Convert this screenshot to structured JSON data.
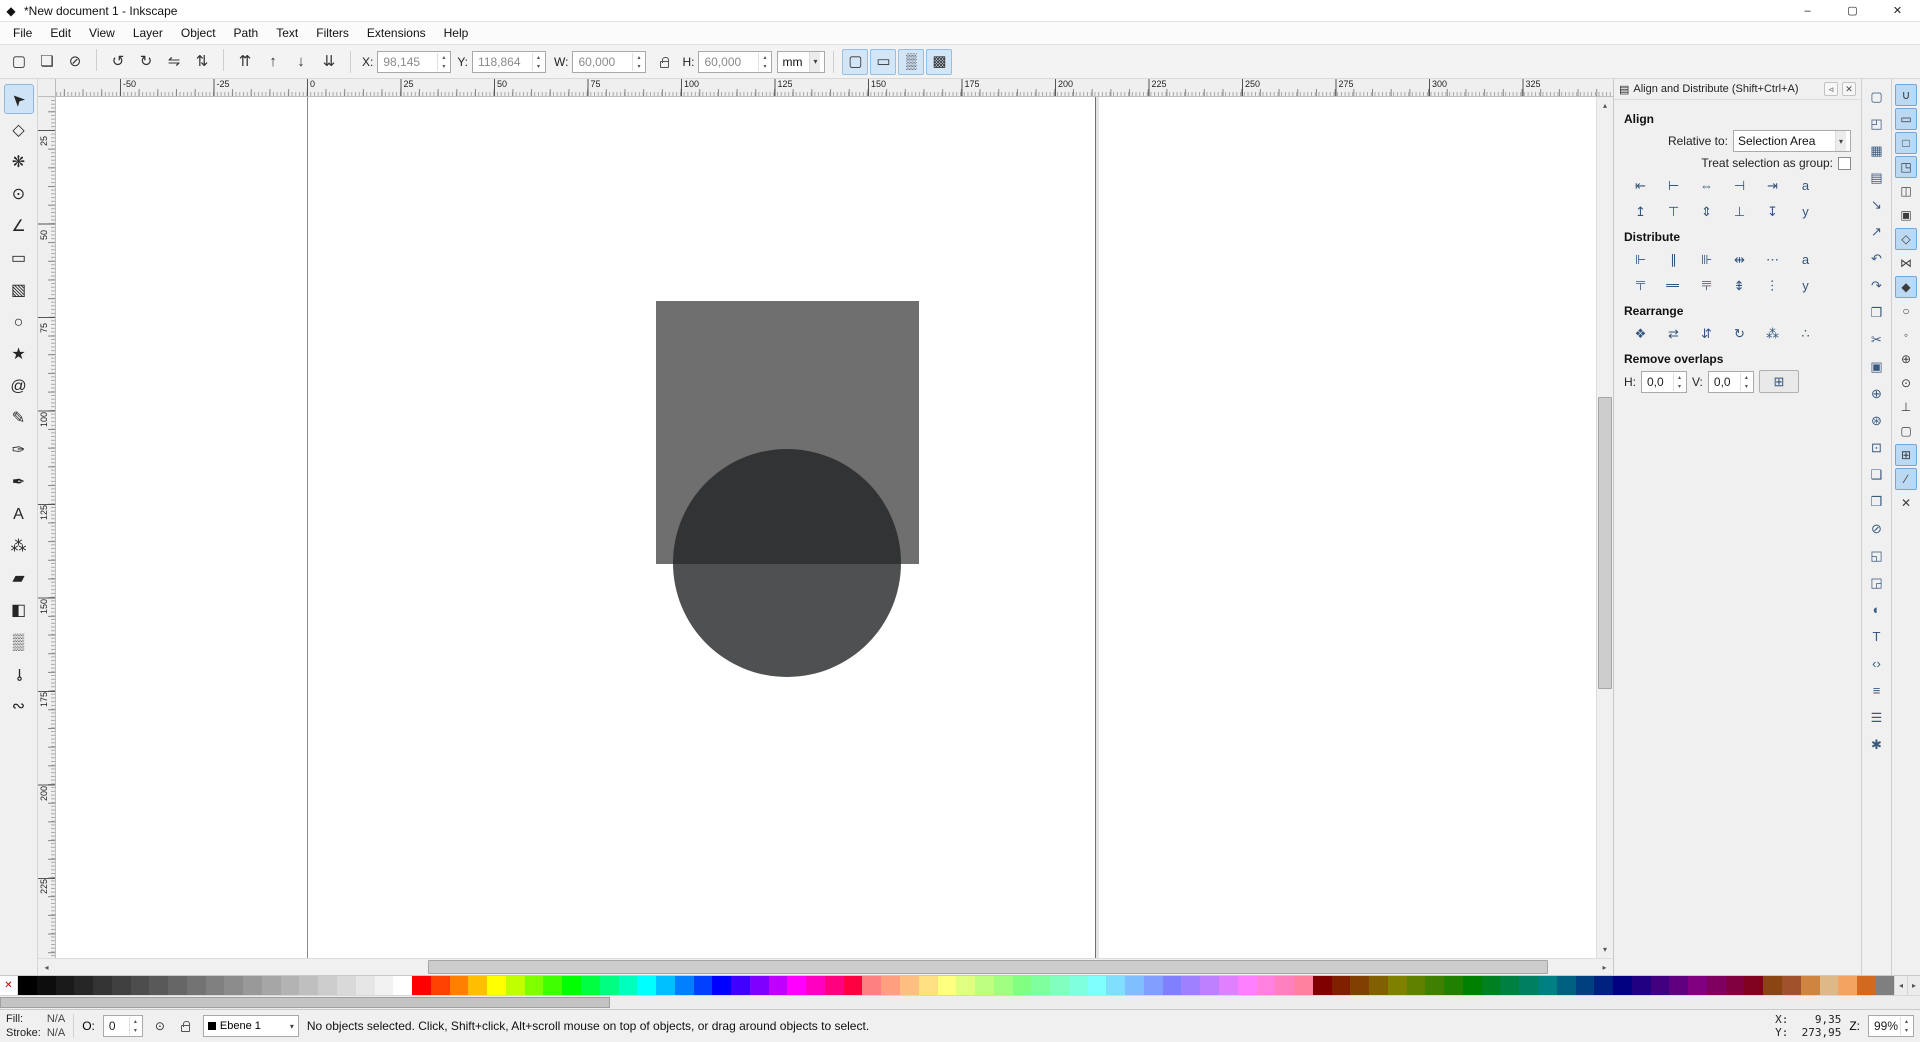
{
  "titlebar": {
    "icon": "◆",
    "title": "*New document 1 - Inkscape",
    "minimize": "–",
    "maximize": "▢",
    "close": "✕"
  },
  "menubar": {
    "items": [
      "File",
      "Edit",
      "View",
      "Layer",
      "Object",
      "Path",
      "Text",
      "Filters",
      "Extensions",
      "Help"
    ]
  },
  "options_toolbar": {
    "groups": [
      [
        {
          "name": "select-all-button",
          "glyph": "▢"
        },
        {
          "name": "select-all-layers-button",
          "glyph": "❏"
        },
        {
          "name": "deselect-button",
          "glyph": "⊘"
        }
      ],
      [
        {
          "name": "rotate-ccw-button",
          "glyph": "↺"
        },
        {
          "name": "rotate-cw-button",
          "glyph": "↻"
        },
        {
          "name": "flip-horizontal-button",
          "glyph": "⇋"
        },
        {
          "name": "flip-vertical-button",
          "glyph": "⇅"
        }
      ],
      [
        {
          "name": "raise-to-top-button",
          "glyph": "⇈"
        },
        {
          "name": "raise-button",
          "glyph": "↑"
        },
        {
          "name": "lower-button",
          "glyph": "↓"
        },
        {
          "name": "lower-to-bottom-button",
          "glyph": "⇊"
        }
      ]
    ],
    "fields_xy": [
      {
        "label": "X:",
        "value": "98,145",
        "name": "x-field"
      },
      {
        "label": "Y:",
        "value": "118,864",
        "name": "y-field"
      }
    ],
    "field_w": [
      {
        "label": "W:",
        "value": "60,000",
        "name": "w-field"
      }
    ],
    "field_h": [
      {
        "label": "H:",
        "value": "60,000",
        "name": "h-field"
      }
    ],
    "unit": "mm",
    "affect_buttons": [
      {
        "name": "scale-stroke-toggle",
        "glyph": "▢"
      },
      {
        "name": "scale-corners-toggle",
        "glyph": "▭"
      },
      {
        "name": "move-gradients-toggle",
        "glyph": "▒"
      },
      {
        "name": "move-patterns-toggle",
        "glyph": "▩"
      }
    ]
  },
  "toolbox": {
    "tools": [
      {
        "name": "selector-tool",
        "glyph": "➤",
        "rot": -135,
        "active": true
      },
      {
        "name": "node-editor-tool",
        "glyph": "◇"
      },
      {
        "name": "tweak-tool",
        "glyph": "❋"
      },
      {
        "name": "zoom-tool",
        "glyph": "⊙"
      },
      {
        "name": "measure-tool",
        "glyph": "∠"
      },
      {
        "name": "rectangle-tool",
        "glyph": "▭"
      },
      {
        "name": "3d-box-tool",
        "glyph": "▧"
      },
      {
        "name": "ellipse-tool",
        "glyph": "○"
      },
      {
        "name": "star-tool",
        "glyph": "★"
      },
      {
        "name": "spiral-tool",
        "glyph": "@"
      },
      {
        "name": "pencil-tool",
        "glyph": "✎"
      },
      {
        "name": "bezier-pen-tool",
        "glyph": "✑"
      },
      {
        "name": "calligraphy-tool",
        "glyph": "✒"
      },
      {
        "name": "text-tool",
        "glyph": "A"
      },
      {
        "name": "spray-tool",
        "glyph": "⁂"
      },
      {
        "name": "eraser-tool",
        "glyph": "▰"
      },
      {
        "name": "paint-bucket-tool",
        "glyph": "◧"
      },
      {
        "name": "gradient-tool",
        "glyph": "▒"
      },
      {
        "name": "dropper-tool",
        "glyph": "⊸",
        "rot": 90
      },
      {
        "name": "connector-tool",
        "glyph": "∾"
      }
    ]
  },
  "rulers": {
    "h": {
      "start": 64,
      "step": 93.5,
      "labels": [
        "-50",
        "-25",
        "0",
        "25",
        "50",
        "75",
        "100",
        "125",
        "150",
        "175",
        "200",
        "225",
        "250",
        "275",
        "300",
        "325"
      ]
    },
    "v": {
      "start": 33,
      "step": 93.5,
      "labels": [
        "25",
        "50",
        "75",
        "100",
        "125",
        "150",
        "175",
        "200",
        "225"
      ]
    }
  },
  "canvas": {
    "rect_color": "#6f6f6f",
    "circle_color": "rgba(34,36,38,0.8)"
  },
  "align_panel": {
    "title": "Align and Distribute (Shift+Ctrl+A)",
    "collapse_glyph": "◃",
    "close_glyph": "✕",
    "header_icon": "▤",
    "align_label": "Align",
    "relative_label": "Relative to:",
    "relative_value": "Selection Area",
    "group_label": "Treat selection as group:",
    "distribute_label": "Distribute",
    "rearrange_label": "Rearrange",
    "remove_label": "Remove overlaps",
    "align_row1": [
      {
        "name": "align-right-edges-to-left-of-anchor-button",
        "glyph": "⇤"
      },
      {
        "name": "align-left-edges-button",
        "glyph": "⊢"
      },
      {
        "name": "center-on-vertical-axis-button",
        "glyph": "⇔"
      },
      {
        "name": "align-right-edges-button",
        "glyph": "⊣"
      },
      {
        "name": "align-left-edges-to-right-of-anchor-button",
        "glyph": "⇥"
      },
      {
        "name": "align-text-anchors-horizontal-button",
        "glyph": "a"
      }
    ],
    "align_row2": [
      {
        "name": "align-bottom-edges-to-top-of-anchor-button",
        "glyph": "↥"
      },
      {
        "name": "align-top-edges-button",
        "glyph": "⊤"
      },
      {
        "name": "center-on-horizontal-axis-button",
        "glyph": "⇕"
      },
      {
        "name": "align-bottom-edges-button",
        "glyph": "⊥"
      },
      {
        "name": "align-top-edges-to-bottom-of-anchor-button",
        "glyph": "↧"
      },
      {
        "name": "align-text-baselines-button",
        "glyph": "y"
      }
    ],
    "distribute_row1": [
      {
        "name": "distribute-left-edges-button",
        "glyph": "⊩"
      },
      {
        "name": "distribute-centers-horizontally-button",
        "glyph": "∥"
      },
      {
        "name": "distribute-right-edges-button",
        "glyph": "⊪"
      },
      {
        "name": "make-horizontal-gaps-equal-button",
        "glyph": "⇹"
      },
      {
        "name": "distribute-text-anchors-horizontally-button",
        "glyph": "⋯"
      },
      {
        "name": "distribute-text-horizontal-button",
        "glyph": "a"
      }
    ],
    "distribute_row2": [
      {
        "name": "distribute-bottom-edges-button",
        "glyph": "⊩",
        "rot": 90
      },
      {
        "name": "distribute-centers-vertically-button",
        "glyph": "∥",
        "rot": 90
      },
      {
        "name": "distribute-top-edges-button",
        "glyph": "⊪",
        "rot": 90
      },
      {
        "name": "make-vertical-gaps-equal-button",
        "glyph": "⇹",
        "rot": 90
      },
      {
        "name": "distribute-text-anchors-vertically-button",
        "glyph": "⋯",
        "rot": 90
      },
      {
        "name": "distribute-text-baselines-vertically-button",
        "glyph": "y"
      }
    ],
    "rearrange_row": [
      {
        "name": "arrange-connector-network-button",
        "glyph": "❖"
      },
      {
        "name": "exchange-in-selection-order-button",
        "glyph": "⇄"
      },
      {
        "name": "exchange-in-stacking-order-button",
        "glyph": "⇵"
      },
      {
        "name": "exchange-clockwise-button",
        "glyph": "↻"
      },
      {
        "name": "randomize-centers-button",
        "glyph": "⁂"
      },
      {
        "name": "unclump-button",
        "glyph": "∴"
      }
    ],
    "remove": {
      "h_label": "H:",
      "h_value": "0,0",
      "v_label": "V:",
      "v_value": "0,0",
      "button_glyph": "⊞"
    }
  },
  "commands_bar": {
    "buttons": [
      {
        "name": "new-document-button",
        "glyph": "▢"
      },
      {
        "name": "open-document-button",
        "glyph": "◰"
      },
      {
        "name": "save-document-button",
        "glyph": "▦"
      },
      {
        "name": "print-document-button",
        "glyph": "▤"
      },
      {
        "name": "import-bitmap-button",
        "glyph": "↘"
      },
      {
        "name": "export-bitmap-button",
        "glyph": "↗"
      },
      {
        "name": "undo-button",
        "glyph": "↶"
      },
      {
        "name": "redo-button",
        "glyph": "↷"
      },
      {
        "name": "copy-button",
        "glyph": "❐"
      },
      {
        "name": "cut-button",
        "glyph": "✂"
      },
      {
        "name": "paste-button",
        "glyph": "▣"
      },
      {
        "name": "zoom-to-fit-selection-button",
        "glyph": "⊕"
      },
      {
        "name": "zoom-to-fit-drawing-button",
        "glyph": "⊛"
      },
      {
        "name": "zoom-to-fit-page-button",
        "glyph": "⊡"
      },
      {
        "name": "duplicate-button",
        "glyph": "❑"
      },
      {
        "name": "create-clone-button",
        "glyph": "❒"
      },
      {
        "name": "unlink-clone-button",
        "glyph": "⊘"
      },
      {
        "name": "group-objects-button",
        "glyph": "◱"
      },
      {
        "name": "ungroup-objects-button",
        "glyph": "◲"
      },
      {
        "name": "fill-stroke-dialog-button",
        "glyph": "◐"
      },
      {
        "name": "text-dialog-button",
        "glyph": "T"
      },
      {
        "name": "xml-editor-button",
        "glyph": "‹›"
      },
      {
        "name": "align-dialog-button",
        "glyph": "≡"
      },
      {
        "name": "document-properties-button",
        "glyph": "☰"
      },
      {
        "name": "preferences-button",
        "glyph": "✱"
      }
    ]
  },
  "snap_bar": {
    "buttons": [
      {
        "name": "snap-enable-button",
        "glyph": "∪",
        "active": true
      },
      {
        "name": "snap-bounding-box-button",
        "glyph": "▭",
        "active": true
      },
      {
        "name": "snap-bbox-edges-button",
        "glyph": "□",
        "active": true
      },
      {
        "name": "snap-bbox-corners-button",
        "glyph": "◳",
        "active": true
      },
      {
        "name": "snap-bbox-edge-midpoints-button",
        "glyph": "◫"
      },
      {
        "name": "snap-bbox-centers-button",
        "glyph": "▣"
      },
      {
        "name": "snap-nodes-button",
        "glyph": "◇",
        "active": true
      },
      {
        "name": "snap-path-intersections-button",
        "glyph": "⋈"
      },
      {
        "name": "snap-cusp-nodes-button",
        "glyph": "◆",
        "active": true
      },
      {
        "name": "snap-smooth-nodes-button",
        "glyph": "○"
      },
      {
        "name": "snap-line-midpoints-button",
        "glyph": "◦"
      },
      {
        "name": "snap-object-centers-button",
        "glyph": "⊕"
      },
      {
        "name": "snap-rotation-centers-button",
        "glyph": "⊙"
      },
      {
        "name": "snap-text-baselines-button",
        "glyph": "⊥"
      },
      {
        "name": "snap-page-border-button",
        "glyph": "▢"
      },
      {
        "name": "snap-grids-button",
        "glyph": "⊞",
        "active": true
      },
      {
        "name": "snap-guides-button",
        "glyph": "∕",
        "active": true
      },
      {
        "name": "snap-guide-intersections-button",
        "glyph": "✕"
      }
    ]
  },
  "palette": {
    "none_glyph": "✕",
    "colors": [
      "#000000",
      "#0d0d0d",
      "#1a1a1a",
      "#262626",
      "#333333",
      "#404040",
      "#4d4d4d",
      "#595959",
      "#666666",
      "#737373",
      "#808080",
      "#8c8c8c",
      "#999999",
      "#a6a6a6",
      "#b3b3b3",
      "#bfbfbf",
      "#cccccc",
      "#d9d9d9",
      "#e6e6e6",
      "#f2f2f2",
      "#ffffff",
      "#ff0000",
      "#ff4000",
      "#ff8000",
      "#ffbf00",
      "#ffff00",
      "#bfff00",
      "#80ff00",
      "#40ff00",
      "#00ff00",
      "#00ff40",
      "#00ff80",
      "#00ffbf",
      "#00ffff",
      "#00bfff",
      "#0080ff",
      "#0040ff",
      "#0000ff",
      "#4000ff",
      "#8000ff",
      "#bf00ff",
      "#ff00ff",
      "#ff00bf",
      "#ff0080",
      "#ff0040",
      "#ff8080",
      "#ff9f80",
      "#ffbf80",
      "#ffdf80",
      "#ffff80",
      "#dfff80",
      "#bfff80",
      "#9fff80",
      "#80ff80",
      "#80ff9f",
      "#80ffbf",
      "#80ffdf",
      "#80ffff",
      "#80dfff",
      "#80bfff",
      "#809fff",
      "#8080ff",
      "#9f80ff",
      "#bf80ff",
      "#df80ff",
      "#ff80ff",
      "#ff80df",
      "#ff80bf",
      "#ff809f",
      "#800000",
      "#802000",
      "#804000",
      "#806000",
      "#808000",
      "#608000",
      "#408000",
      "#208000",
      "#008000",
      "#008020",
      "#008040",
      "#008060",
      "#008080",
      "#006080",
      "#004080",
      "#002080",
      "#000080",
      "#200080",
      "#400080",
      "#600080",
      "#800080",
      "#800060",
      "#800040",
      "#800020",
      "#8b4513",
      "#a0522d",
      "#cd853f",
      "#deb887",
      "#f4a460",
      "#d2691e",
      "#7f7f7f"
    ]
  },
  "statusbar": {
    "fill_label": "Fill:",
    "fill_value": "N/A",
    "stroke_label": "Stroke:",
    "stroke_value": "N/A",
    "opacity_label": "O:",
    "opacity_value": "0",
    "layer_name": "Ebene 1",
    "message": "No objects selected. Click, Shift+click, Alt+scroll mouse on top of objects, or drag around objects to select.",
    "xy_text": "X:    9,35\nY:  273,95",
    "zoom_label": "Z:",
    "zoom_value": "99%"
  }
}
